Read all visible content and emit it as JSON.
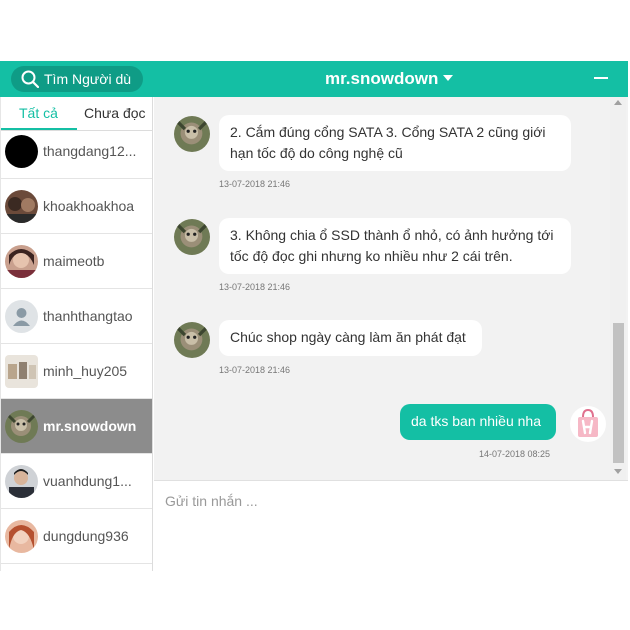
{
  "colors": {
    "accent": "#14bfa4",
    "selected_row": "#8c8c8c"
  },
  "header": {
    "search_placeholder": "Tìm Người dù",
    "chat_title": "mr.snowdown"
  },
  "tabs": [
    {
      "label": "Tất cả",
      "active": true
    },
    {
      "label": "Chưa đọc",
      "active": false
    }
  ],
  "contacts": [
    {
      "name": "thangdang12...",
      "avatar": "black-circle"
    },
    {
      "name": "khoakhoakhoa",
      "avatar": "photo"
    },
    {
      "name": "maimeotb",
      "avatar": "photo"
    },
    {
      "name": "thanhthangtao",
      "avatar": "default-user-icon"
    },
    {
      "name": "minh_huy205",
      "avatar": "photo"
    },
    {
      "name": "mr.snowdown",
      "avatar": "photo",
      "selected": true
    },
    {
      "name": "vuanhdung1...",
      "avatar": "photo"
    },
    {
      "name": "dungdung936",
      "avatar": "photo"
    }
  ],
  "messages": [
    {
      "from": "other",
      "text": "2. Cắm đúng cổng SATA 3. Cổng SATA 2 cũng giới hạn tốc độ do công nghệ cũ",
      "time": "13-07-2018 21:46"
    },
    {
      "from": "other",
      "text": "3. Không chia ổ SSD thành ổ nhỏ, có ảnh hưởng tới tốc độ đọc ghi nhưng ko nhiều như 2 cái trên.",
      "time": "13-07-2018 21:46"
    },
    {
      "from": "other",
      "text": "Chúc shop ngày càng làm ăn phát đạt",
      "time": "13-07-2018 21:46"
    },
    {
      "from": "me",
      "text": "da tks ban nhiều nha",
      "time": "14-07-2018 08:25"
    }
  ],
  "compose": {
    "placeholder": "Gửi tin nhắn ..."
  },
  "scrollbar": {
    "position_fraction": 0.62
  }
}
